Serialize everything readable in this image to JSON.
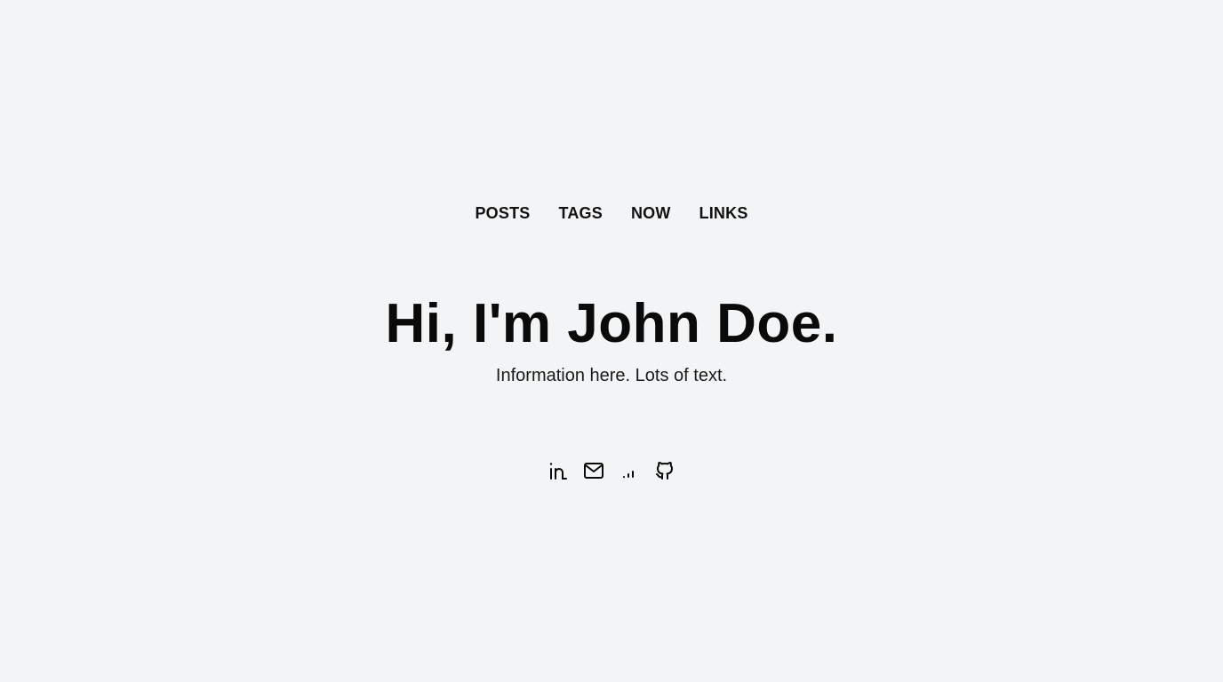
{
  "nav": {
    "items": [
      {
        "label": "POSTS"
      },
      {
        "label": "TAGS"
      },
      {
        "label": "NOW"
      },
      {
        "label": "LINKS"
      }
    ]
  },
  "hero": {
    "title": "Hi, I'm John Doe.",
    "subtitle": "Information here. Lots of text."
  },
  "social": {
    "icons": [
      "linkedin-icon",
      "mail-icon",
      "signal-icon",
      "github-icon"
    ]
  }
}
